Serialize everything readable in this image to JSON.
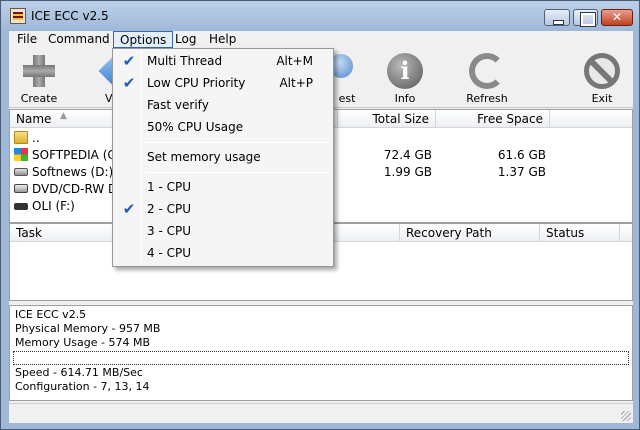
{
  "window": {
    "title": "ICE ECC v2.5"
  },
  "menubar": {
    "items": [
      {
        "label": "File"
      },
      {
        "label": "Command"
      },
      {
        "label": "Options"
      },
      {
        "label": "Log"
      },
      {
        "label": "Help"
      }
    ]
  },
  "toolbar": {
    "create": "Create",
    "verify": "V",
    "test": "est",
    "info": "Info",
    "refresh": "Refresh",
    "exit": "Exit"
  },
  "drives": {
    "columns": {
      "name": "Name",
      "total": "Total Size",
      "free": "Free Space"
    },
    "rows": [
      {
        "name": "..",
        "total": "",
        "free": "",
        "icon": "folder-icon"
      },
      {
        "name": "SOFTPEDIA (C:)",
        "total": "72.4 GB",
        "free": "61.6 GB",
        "icon": "windows-drive-icon"
      },
      {
        "name": "Softnews (D:)",
        "total": "1.99 GB",
        "free": "1.37 GB",
        "icon": "hard-drive-icon"
      },
      {
        "name": "DVD/CD-RW Dr",
        "total": "",
        "free": "",
        "icon": "dvd-drive-icon"
      },
      {
        "name": "OLI (F:)",
        "total": "",
        "free": "",
        "icon": "usb-drive-icon"
      }
    ]
  },
  "tasks": {
    "columns": {
      "task": "Task",
      "recovery": "Recovery Path",
      "status": "Status"
    }
  },
  "log": {
    "lines": [
      "ICE ECC v2.5",
      "Physical Memory - 957 MB",
      "Memory Usage - 574 MB",
      "Speed - 614.71 MB/Sec",
      "Configuration - 7, 13, 14"
    ]
  },
  "options_menu": {
    "items": [
      {
        "label": "Multi Thread",
        "accel": "Alt+M",
        "checked": true
      },
      {
        "label": "Low CPU Priority",
        "accel": "Alt+P",
        "checked": true
      },
      {
        "label": "Fast verify",
        "accel": "",
        "checked": false
      },
      {
        "label": "50% CPU Usage",
        "accel": "",
        "checked": false
      },
      {
        "label": "Set memory usage",
        "accel": "",
        "checked": false
      },
      {
        "label": "1 - CPU",
        "accel": "",
        "checked": false
      },
      {
        "label": "2 - CPU",
        "accel": "",
        "checked": true
      },
      {
        "label": "3 - CPU",
        "accel": "",
        "checked": false
      },
      {
        "label": "4 - CPU",
        "accel": "",
        "checked": false
      }
    ],
    "check_glyph": "✔"
  }
}
